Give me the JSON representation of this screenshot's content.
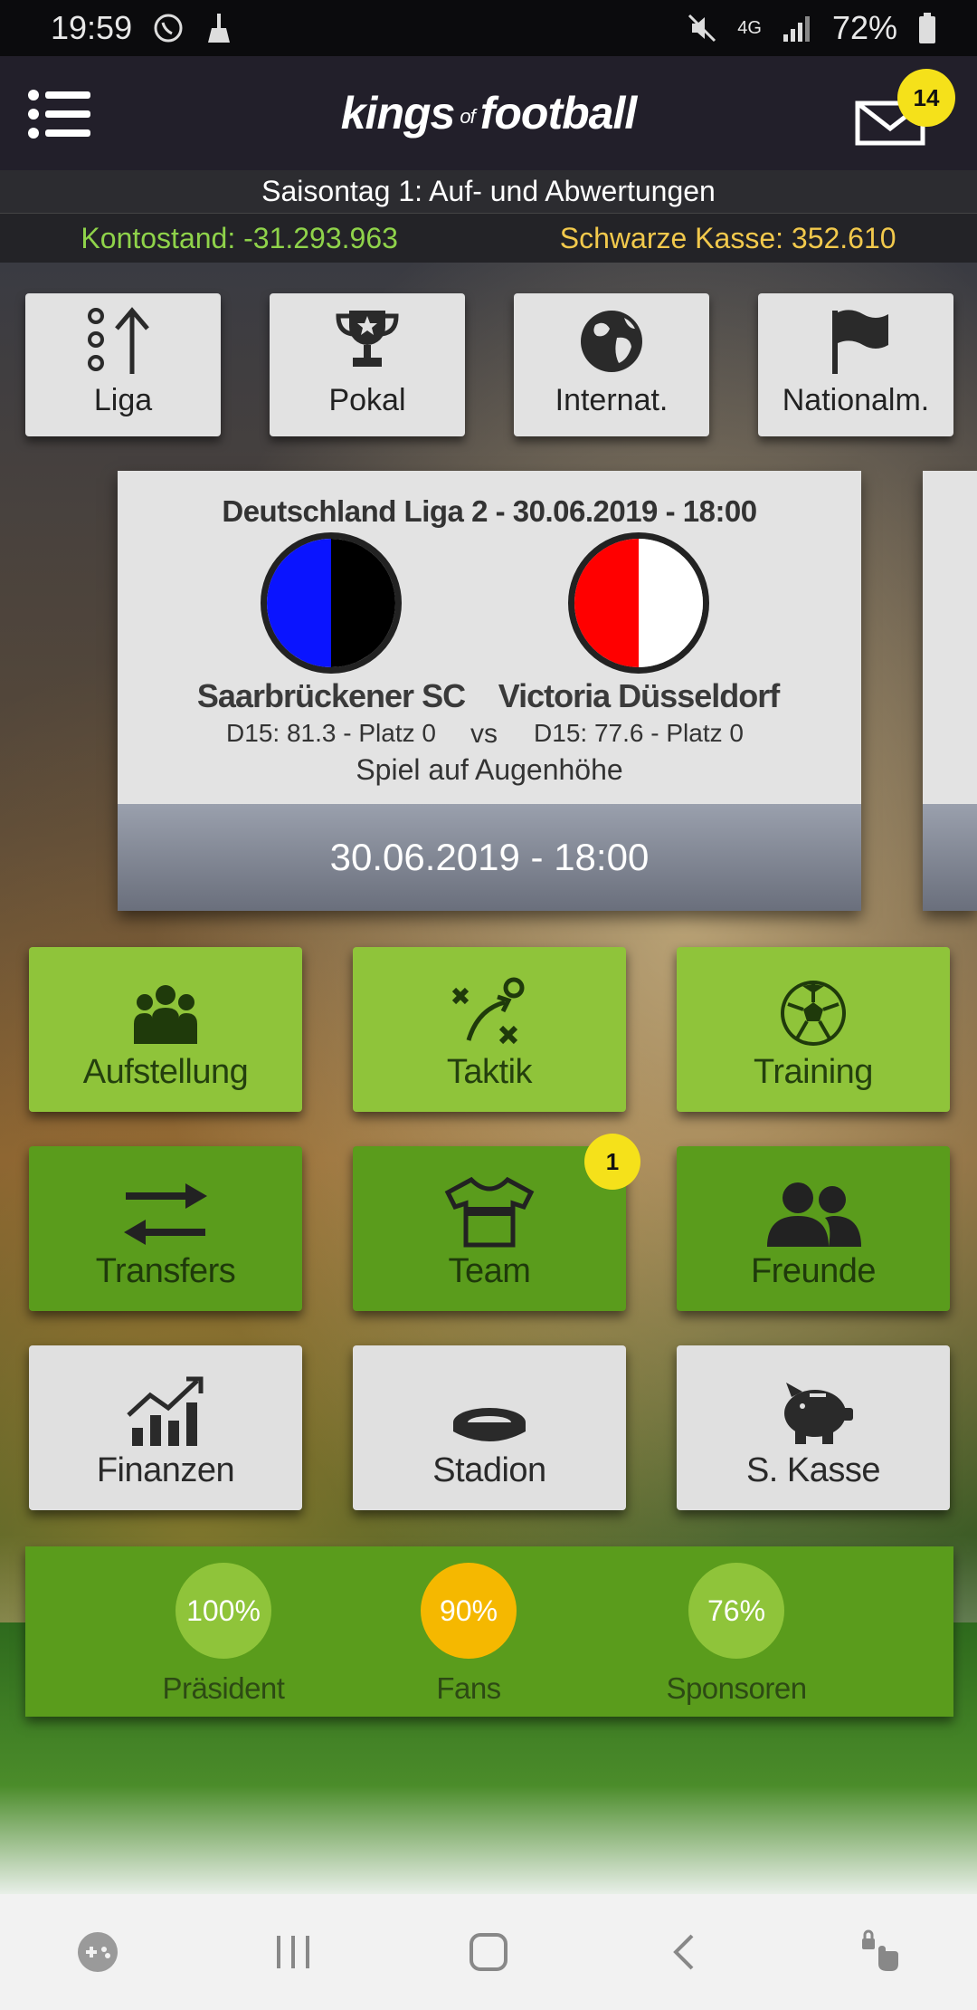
{
  "status_bar": {
    "time": "19:59",
    "network": "4G",
    "battery": "72%"
  },
  "header": {
    "logo_main": "kings",
    "logo_of": "of",
    "logo_end": "football",
    "mail_count": "14"
  },
  "season": {
    "label": "Saisontag 1: Auf- und Abwertungen"
  },
  "money": {
    "balance": "Kontostand: -31.293.963",
    "black_cash": "Schwarze Kasse: 352.610"
  },
  "top_nav": [
    {
      "label": "Liga",
      "icon": "league-ranking-icon"
    },
    {
      "label": "Pokal",
      "icon": "trophy-icon"
    },
    {
      "label": "Internat.",
      "icon": "globe-icon"
    },
    {
      "label": "Nationalm.",
      "icon": "flag-icon"
    }
  ],
  "match": {
    "title": "Deutschland Liga 2 - 30.06.2019 - 18:00",
    "home": {
      "name": "Saarbrückener SC",
      "stats": "D15: 81.3 - Platz 0",
      "color_left": "#0a14ff",
      "color_right": "#000000"
    },
    "away": {
      "name": "Victoria Düsseldorf",
      "stats": "D15: 77.6 - Platz 0",
      "color_left": "#ff0000",
      "color_right": "#ffffff"
    },
    "vs": "vs",
    "note": "Spiel auf Augenhöhe",
    "footer": "30.06.2019 - 18:00"
  },
  "tiles": [
    {
      "label": "Aufstellung",
      "icon": "lineup-people-icon",
      "style": "light"
    },
    {
      "label": "Taktik",
      "icon": "tactics-icon",
      "style": "light"
    },
    {
      "label": "Training",
      "icon": "soccer-ball-icon",
      "style": "light"
    },
    {
      "label": "Transfers",
      "icon": "transfer-arrows-icon",
      "style": "dark"
    },
    {
      "label": "Team",
      "icon": "jersey-icon",
      "style": "dark",
      "badge": "1"
    },
    {
      "label": "Freunde",
      "icon": "friends-icon",
      "style": "dark"
    },
    {
      "label": "Finanzen",
      "icon": "finance-chart-icon",
      "style": "grey"
    },
    {
      "label": "Stadion",
      "icon": "stadium-icon",
      "style": "grey"
    },
    {
      "label": "S. Kasse",
      "icon": "piggy-bank-icon",
      "style": "grey"
    }
  ],
  "satisfaction": [
    {
      "label": "Präsident",
      "value": "100%",
      "color": "#8fc43a"
    },
    {
      "label": "Fans",
      "value": "90%",
      "color": "#f5b800"
    },
    {
      "label": "Sponsoren",
      "value": "76%",
      "color": "#8fc43a"
    }
  ]
}
